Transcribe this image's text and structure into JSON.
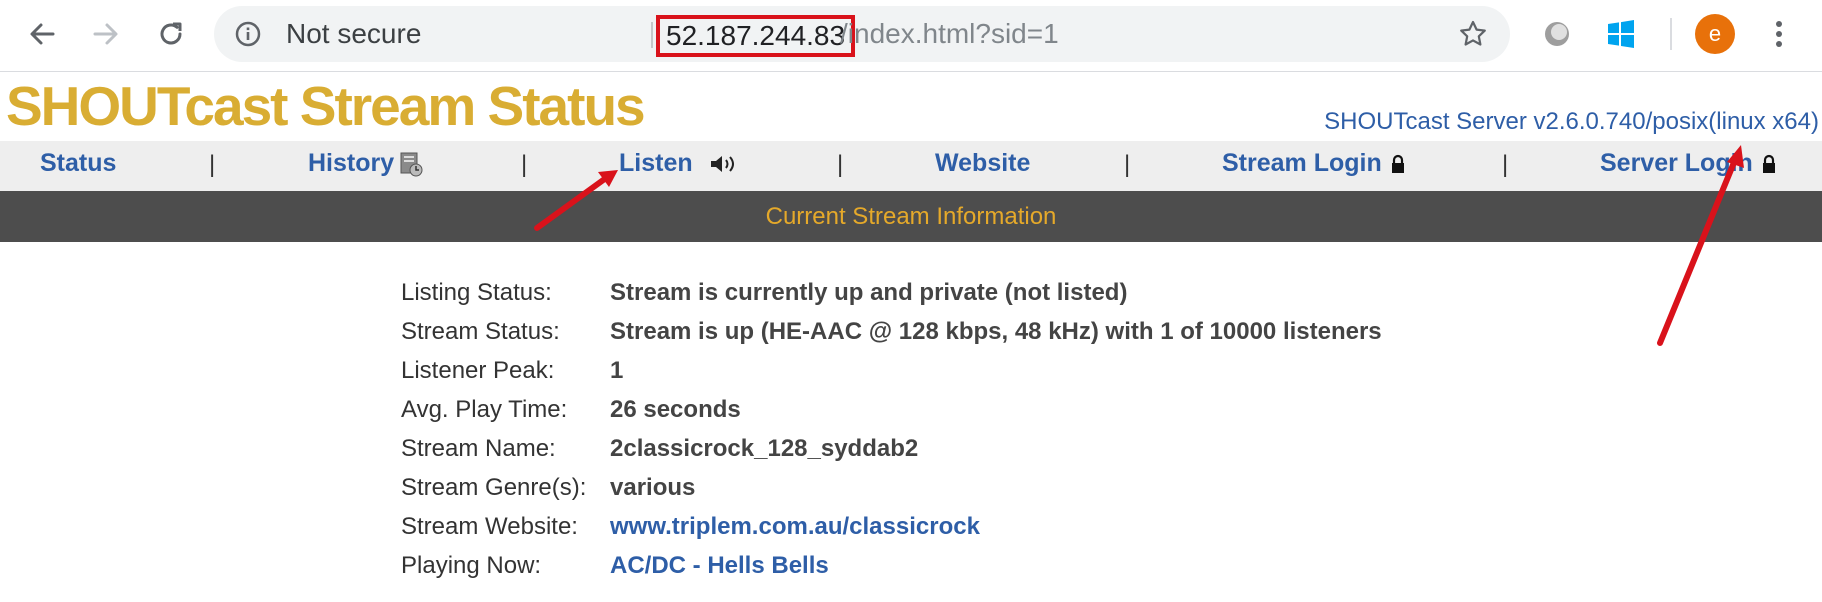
{
  "browser": {
    "security_label": "Not secure",
    "url_host": "52.187.244.83",
    "url_path": "/index.html?sid=1",
    "avatar_letter": "e"
  },
  "page": {
    "title": "SHOUTcast Stream Status",
    "server_info": "SHOUTcast Server v2.6.0.740/posix(linux x64)"
  },
  "nav": {
    "status": "Status",
    "history": "History",
    "listen": "Listen",
    "website": "Website",
    "stream_login": "Stream Login",
    "server_login": "Server Login",
    "separator": "|"
  },
  "info_header": "Current Stream Information",
  "stream_info": [
    {
      "label": "Listing Status:",
      "value": "Stream is currently up and private (not listed)"
    },
    {
      "label": "Stream Status:",
      "value": "Stream is up (HE-AAC @ 128 kbps, 48 kHz) with 1 of 10000 listeners"
    },
    {
      "label": "Listener Peak:",
      "value": "1"
    },
    {
      "label": "Avg. Play Time:",
      "value": "26 seconds"
    },
    {
      "label": "Stream Name:",
      "value": "2classicrock_128_syddab2"
    },
    {
      "label": "Stream Genre(s):",
      "value": "various"
    },
    {
      "label": "Stream Website:",
      "value": "www.triplem.com.au/classicrock"
    },
    {
      "label": "Playing Now:",
      "value": "AC/DC - Hells Bells"
    }
  ],
  "colors": {
    "title": "#d9ad33",
    "link": "#2e5ea7",
    "infobar_bg": "#4d4d4d",
    "infobar_text": "#e5a92a",
    "annotation": "#d9121b"
  }
}
